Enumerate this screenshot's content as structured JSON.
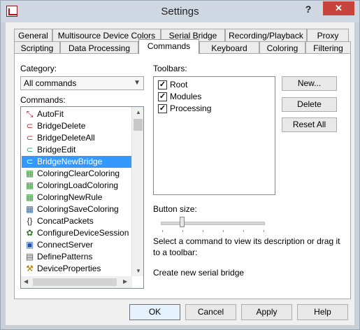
{
  "window": {
    "title": "Settings",
    "help_glyph": "?",
    "close_glyph": "✕"
  },
  "tabs_row1": [
    "General",
    "Multisource Device Colors",
    "Serial Bridge",
    "Recording/Playback",
    "Proxy"
  ],
  "tabs_row2": [
    "Scripting",
    "Data Processing",
    "Commands",
    "Keyboard",
    "Coloring",
    "Filtering"
  ],
  "active_tab": "Commands",
  "category": {
    "label": "Category:",
    "value": "All commands"
  },
  "commands": {
    "label": "Commands:",
    "selected": "BridgeNewBridge",
    "items": [
      {
        "label": "AutoFit",
        "icon": "autofit-icon"
      },
      {
        "label": "BridgeDelete",
        "icon": "bridge-delete-icon"
      },
      {
        "label": "BridgeDeleteAll",
        "icon": "bridge-delete-all-icon"
      },
      {
        "label": "BridgeEdit",
        "icon": "bridge-edit-icon"
      },
      {
        "label": "BridgeNewBridge",
        "icon": "bridge-new-icon"
      },
      {
        "label": "ColoringClearColoring",
        "icon": "coloring-clear-icon"
      },
      {
        "label": "ColoringLoadColoring",
        "icon": "coloring-load-icon"
      },
      {
        "label": "ColoringNewRule",
        "icon": "coloring-new-rule-icon"
      },
      {
        "label": "ColoringSaveColoring",
        "icon": "coloring-save-icon"
      },
      {
        "label": "ConcatPackets",
        "icon": "concat-packets-icon"
      },
      {
        "label": "ConfigureDeviceSession",
        "icon": "configure-session-icon"
      },
      {
        "label": "ConnectServer",
        "icon": "connect-server-icon"
      },
      {
        "label": "DefinePatterns",
        "icon": "define-patterns-icon"
      },
      {
        "label": "DeviceProperties",
        "icon": "device-properties-icon"
      }
    ]
  },
  "toolbars": {
    "label": "Toolbars:",
    "items": [
      {
        "label": "Root",
        "checked": true
      },
      {
        "label": "Modules",
        "checked": true
      },
      {
        "label": "Processing",
        "checked": true
      }
    ]
  },
  "toolbar_buttons": {
    "new": "New...",
    "delete": "Delete",
    "reset_all": "Reset All"
  },
  "button_size": {
    "label": "Button size:"
  },
  "description": {
    "hint": "Select a command to view its description or drag it to a toolbar:",
    "text": "Create new serial bridge"
  },
  "dialog_buttons": {
    "ok": "OK",
    "cancel": "Cancel",
    "apply": "Apply",
    "help": "Help"
  },
  "colors": {
    "selection": "#3399ff",
    "close": "#c7433b"
  }
}
